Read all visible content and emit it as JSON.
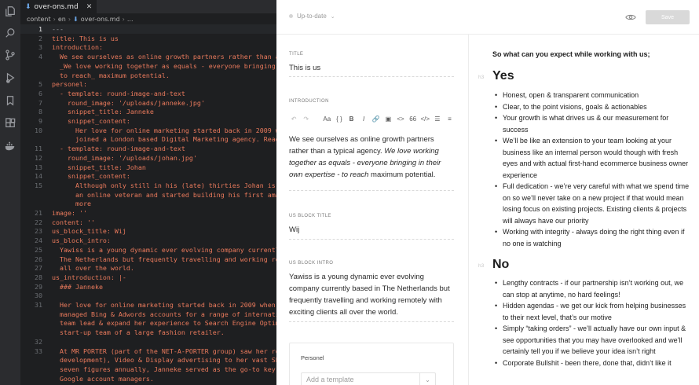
{
  "activity_icons": [
    "explorer-icon",
    "search-icon",
    "source-control-icon",
    "run-debug-icon",
    "bookmarks-icon",
    "extensions-icon",
    "docker-icon"
  ],
  "editor": {
    "tab": {
      "filename": "over-ons.md"
    },
    "breadcrumb": {
      "root": "content",
      "lang": "en",
      "file": "over-ons.md",
      "more": "..."
    },
    "lines": [
      {
        "n": "1",
        "text": "---",
        "plain": true
      },
      {
        "n": "2",
        "text": "title: This is us"
      },
      {
        "n": "3",
        "text": "introduction:"
      },
      {
        "n": "4",
        "text": "  We see ourselves as online growth partners rather than a ty"
      },
      {
        "n": "",
        "text": "  _We love working together as equals - everyone bringing in"
      },
      {
        "n": "",
        "text": "  to reach_ maximum potential."
      },
      {
        "n": "5",
        "text": "personel:"
      },
      {
        "n": "6",
        "text": "  - template: round-image-and-text"
      },
      {
        "n": "7",
        "text": "    round_image: '/uploads/janneke.jpg'"
      },
      {
        "n": "8",
        "text": "    snippet_title: Janneke"
      },
      {
        "n": "9",
        "text": "    snippet_content:"
      },
      {
        "n": "10",
        "text": "      Her love for online marketing started back in 2009 when"
      },
      {
        "n": "",
        "text": "      joined a London based Digital Marketing agency. Read mo"
      },
      {
        "n": "11",
        "text": "  - template: round-image-and-text"
      },
      {
        "n": "12",
        "text": "    round_image: '/uploads/johan.jpg'"
      },
      {
        "n": "13",
        "text": "    snippet_title: Johan"
      },
      {
        "n": "14",
        "text": "    snippet_content:"
      },
      {
        "n": "15",
        "text": "      Although only still in his (late) thirties Johan is som"
      },
      {
        "n": "",
        "text": "      an online veteran and started building his first amateu"
      },
      {
        "n": "",
        "text": "      more"
      },
      {
        "n": "21",
        "text": "image: ''"
      },
      {
        "n": "22",
        "text": "content: ''"
      },
      {
        "n": "23",
        "text": "us_block_title: Wij"
      },
      {
        "n": "24",
        "text": "us_block_intro:"
      },
      {
        "n": "25",
        "text": "  Yawiss is a young dynamic ever evolving company currently b"
      },
      {
        "n": "26",
        "text": "  The Netherlands but frequently travelling and working remot"
      },
      {
        "n": "27",
        "text": "  all over the world."
      },
      {
        "n": "28",
        "text": "us_introduction: |-"
      },
      {
        "n": "29",
        "text": "  ### Janneke"
      },
      {
        "n": "30",
        "text": ""
      },
      {
        "n": "31",
        "text": "  Her love for online marketing started back in 2009 when Jan"
      },
      {
        "n": "",
        "text": "  managed Bing & Adwords accounts for a range of internationa"
      },
      {
        "n": "",
        "text": "  team lead & expand her experience to Search Engine Optimisa"
      },
      {
        "n": "",
        "text": "  start-up team of a large fashion retailer."
      },
      {
        "n": "32",
        "text": ""
      },
      {
        "n": "33",
        "text": "  At MR PORTER (part of the NET-A-PORTER group) saw her role"
      },
      {
        "n": "",
        "text": "  development), Video & Display advertising to her vast SEO &"
      },
      {
        "n": "",
        "text": "  seven figures annually, Janneke served as the go-to key per"
      },
      {
        "n": "",
        "text": "  Google account managers."
      }
    ]
  },
  "cms": {
    "status": "Up-to-date",
    "save_label": "Save",
    "title_label": "TITLE",
    "title_value": "This is us",
    "intro_label": "INTRODUCTION",
    "intro_plain1": "We see ourselves as online growth partners rather than a typical agency.",
    "intro_italic": "We love working together as equals - everyone bringing in their own expertise - to reach",
    "intro_plain2": "maximum potential.",
    "toolbar": [
      "↶",
      "↷",
      "Aa",
      "{ }",
      "B",
      "I",
      "🔗",
      "▣",
      "<>",
      "66",
      "</>",
      "☰",
      "≡"
    ],
    "us_block_title_label": "US BLOCK TITLE",
    "us_block_title_value": "Wij",
    "us_block_intro_label": "US BLOCK INTRO",
    "us_block_intro_value": "Yawiss is a young dynamic ever evolving company currently based in The Netherlands but frequently travelling and working remotely with exciting clients all over the world.",
    "personel_label": "Personel",
    "add_template_placeholder": "Add a template"
  },
  "preview": {
    "intro": "So what can you expect while working with us;",
    "h3_tag": "h3",
    "yes_heading": "Yes",
    "yes_items": [
      "Honest, open & transparent communication",
      "Clear, to the point visions, goals & actionables",
      "Your growth is what drives us & our measurement for success",
      "We’ll be like an extension to your team looking at your business like an internal person would though with fresh eyes and with actual first-hand ecommerce business owner experience",
      "Full dedication - we’re very careful with what we spend time on so we’ll never take on a new project if that would mean losing focus on existing projects. Existing clients & projects will always have our priority",
      "Working with integrity - always doing the right thing even if no one is watching"
    ],
    "no_heading": "No",
    "no_items": [
      "Lengthy contracts - if our partnership isn’t working out, we can stop at anytime, no hard feelings!",
      "Hidden agendas - we get our kick from helping businesses to their next level, that’s our motive",
      "Simply “taking orders” - we’ll actually have our own input & see opportunities that you may have overlooked and we’ll certainly tell you if we believe your idea isn’t right",
      "Corporate Bullshit - been there, done that, didn’t like it"
    ]
  }
}
